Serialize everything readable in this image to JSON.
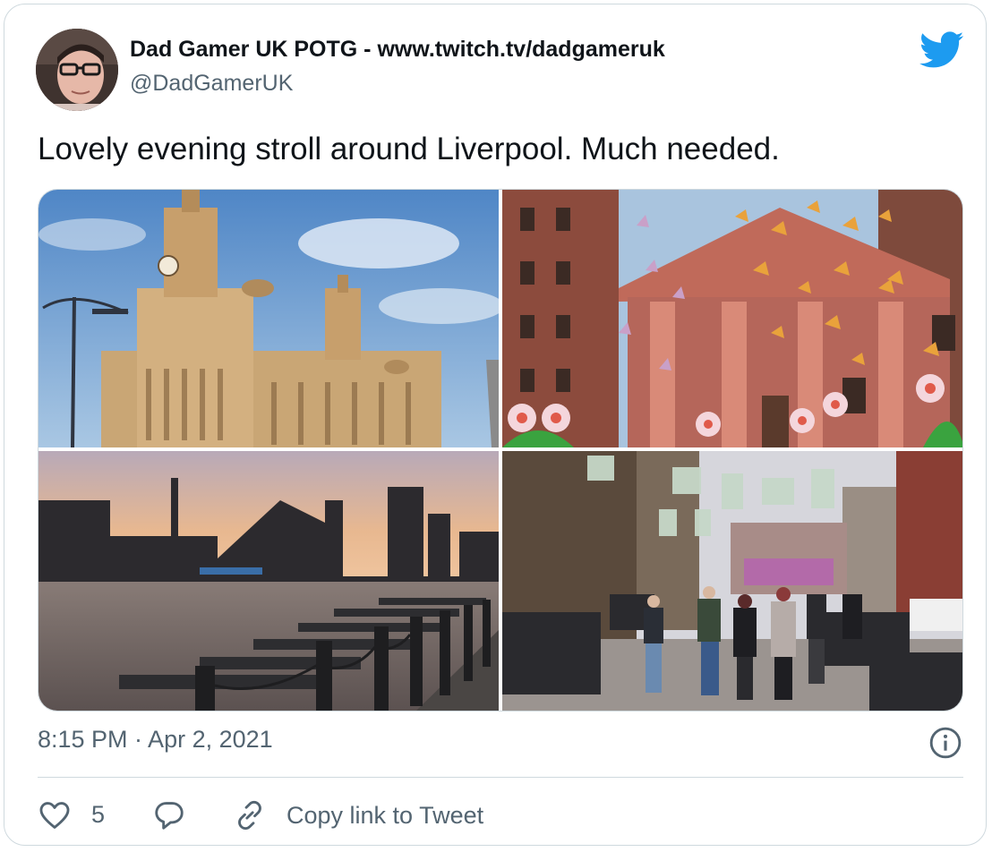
{
  "author": {
    "display_name": "Dad Gamer UK POTG - www.twitch.tv/dadgameruk",
    "handle": "@DadGamerUK",
    "avatar_icon": "profile-photo"
  },
  "tweet": {
    "text": "Lovely evening stroll around Liverpool.  Much needed.",
    "timestamp": "8:15 PM · Apr 2, 2021"
  },
  "media": [
    {
      "name": "photo-royal-liver-building",
      "kind": "photo"
    },
    {
      "name": "photo-butterfly-building-installation",
      "kind": "photo"
    },
    {
      "name": "photo-dock-sunset",
      "kind": "photo"
    },
    {
      "name": "photo-street-with-hanging-clothes",
      "kind": "photo"
    }
  ],
  "actions": {
    "like_count": "5",
    "copy_link_label": "Copy link to Tweet"
  },
  "colors": {
    "brand": "#1d9bf0",
    "secondary_text": "#536471",
    "border": "#cfd9de"
  }
}
